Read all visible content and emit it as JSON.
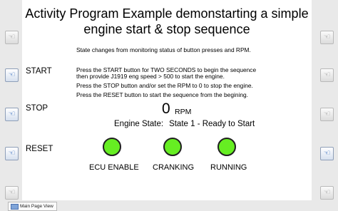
{
  "title_line1": "Activity Program Example demonstarting a simple",
  "title_line2": "engine start & stop sequence",
  "subtitle": "State changes from monitoring status of button presses and RPM.",
  "button_labels": {
    "start": "START",
    "stop": "STOP",
    "reset": "RESET"
  },
  "instructions": {
    "start_line1": "Press the START button for TWO SECONDS to begin the sequence",
    "start_line2": "then provide J1919 eng speed > 500 to start the engine.",
    "stop": "Press the STOP button and/or set the RPM to 0  to stop the engine.",
    "reset": "Press the RESET button to start the sequence from the begining."
  },
  "rpm": {
    "value": "0",
    "unit": "RPM"
  },
  "engine_state": {
    "label": "Engine State:",
    "value": "State 1 - Ready to Start"
  },
  "lamps": [
    {
      "label": "ECU ENABLE",
      "color": "#66ee22"
    },
    {
      "label": "CRANKING",
      "color": "#66ee22"
    },
    {
      "label": "RUNNING",
      "color": "#66ee22"
    }
  ],
  "side_buttons": {
    "left": [
      {
        "icon": "hand-pointer-icon",
        "active": false
      },
      {
        "icon": "hand-pointer-icon",
        "active": true
      },
      {
        "icon": "hand-pointer-icon",
        "active": true
      },
      {
        "icon": "hand-pointer-icon",
        "active": true
      },
      {
        "icon": "hand-pointer-icon",
        "active": false
      }
    ],
    "right": [
      {
        "icon": "hand-pointer-icon",
        "active": false
      },
      {
        "icon": "hand-pointer-icon",
        "active": false
      },
      {
        "icon": "hand-pointer-icon",
        "active": false
      },
      {
        "icon": "hand-pointer-icon",
        "active": true
      },
      {
        "icon": "hand-pointer-icon",
        "active": false
      }
    ]
  },
  "tab": {
    "label": "Main Page View"
  }
}
